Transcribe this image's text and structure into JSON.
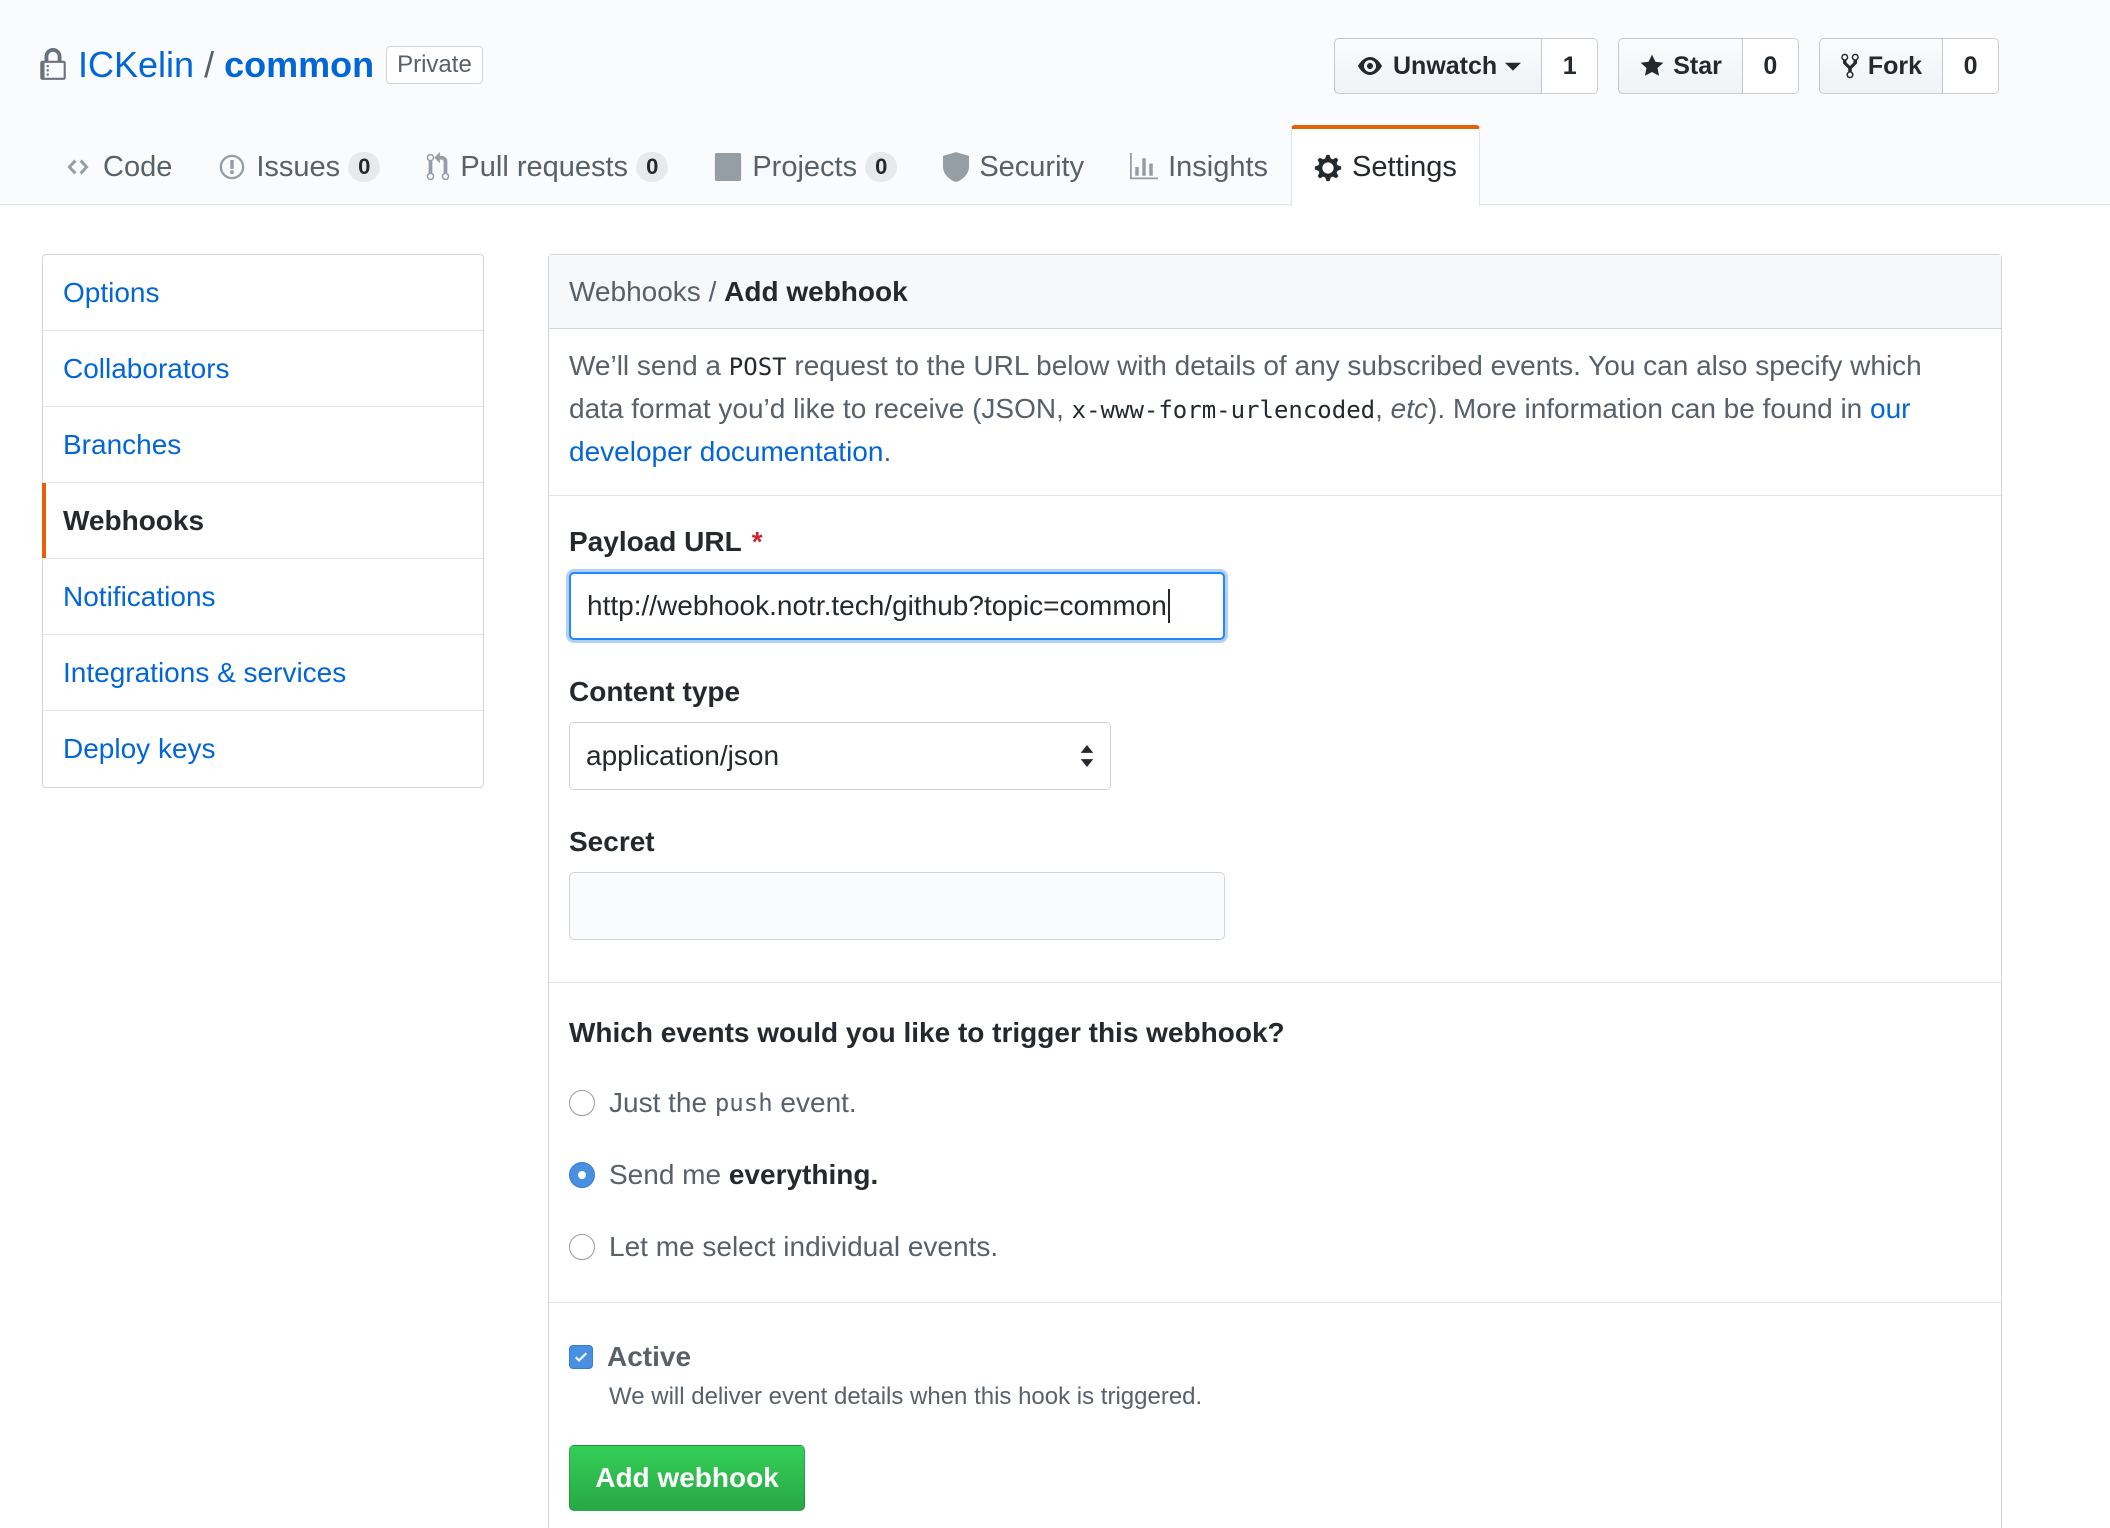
{
  "repo": {
    "owner": "ICKelin",
    "separator": "/",
    "name": "common",
    "visibility": "Private"
  },
  "actions": {
    "watch_label": "Unwatch",
    "watch_count": "1",
    "star_label": "Star",
    "star_count": "0",
    "fork_label": "Fork",
    "fork_count": "0"
  },
  "nav": {
    "code": "Code",
    "issues": "Issues",
    "issues_count": "0",
    "pulls": "Pull requests",
    "pulls_count": "0",
    "projects": "Projects",
    "projects_count": "0",
    "security": "Security",
    "insights": "Insights",
    "settings": "Settings"
  },
  "sidebar": {
    "items": [
      {
        "label": "Options"
      },
      {
        "label": "Collaborators"
      },
      {
        "label": "Branches"
      },
      {
        "label": "Webhooks",
        "selected": true
      },
      {
        "label": "Notifications"
      },
      {
        "label": "Integrations & services"
      },
      {
        "label": "Deploy keys"
      }
    ]
  },
  "main": {
    "breadcrumb_parent": "Webhooks",
    "breadcrumb_sep": " / ",
    "breadcrumb_current": "Add webhook",
    "intro": {
      "p1": "We’ll send a ",
      "code1": "POST",
      "p2": " request to the URL below with details of any subscribed events. You can also specify which data format you’d like to receive (JSON, ",
      "code2": "x-www-form-urlencoded",
      "p3": ", ",
      "etc": "etc",
      "p4": "). More information can be found in ",
      "link": "our developer documentation",
      "p5": "."
    },
    "payload_label": "Payload URL",
    "required_mark": "*",
    "payload_value": "http://webhook.notr.tech/github?topic=common",
    "content_type_label": "Content type",
    "content_type_value": "application/json",
    "secret_label": "Secret",
    "secret_value": "",
    "events_title": "Which events would you like to trigger this webhook?",
    "events": {
      "push_pre": "Just the ",
      "push_code": "push",
      "push_post": " event.",
      "everything_pre": "Send me ",
      "everything_bold": "everything.",
      "individual": "Let me select individual events."
    },
    "selected_event": "everything",
    "active_label": "Active",
    "active_checked": true,
    "active_note": "We will deliver event details when this hook is triggered.",
    "submit_label": "Add webhook"
  },
  "colors": {
    "link": "#0366d6",
    "accent": "#e36209",
    "primary_button": "#28a745",
    "focus": "#2188ff"
  }
}
